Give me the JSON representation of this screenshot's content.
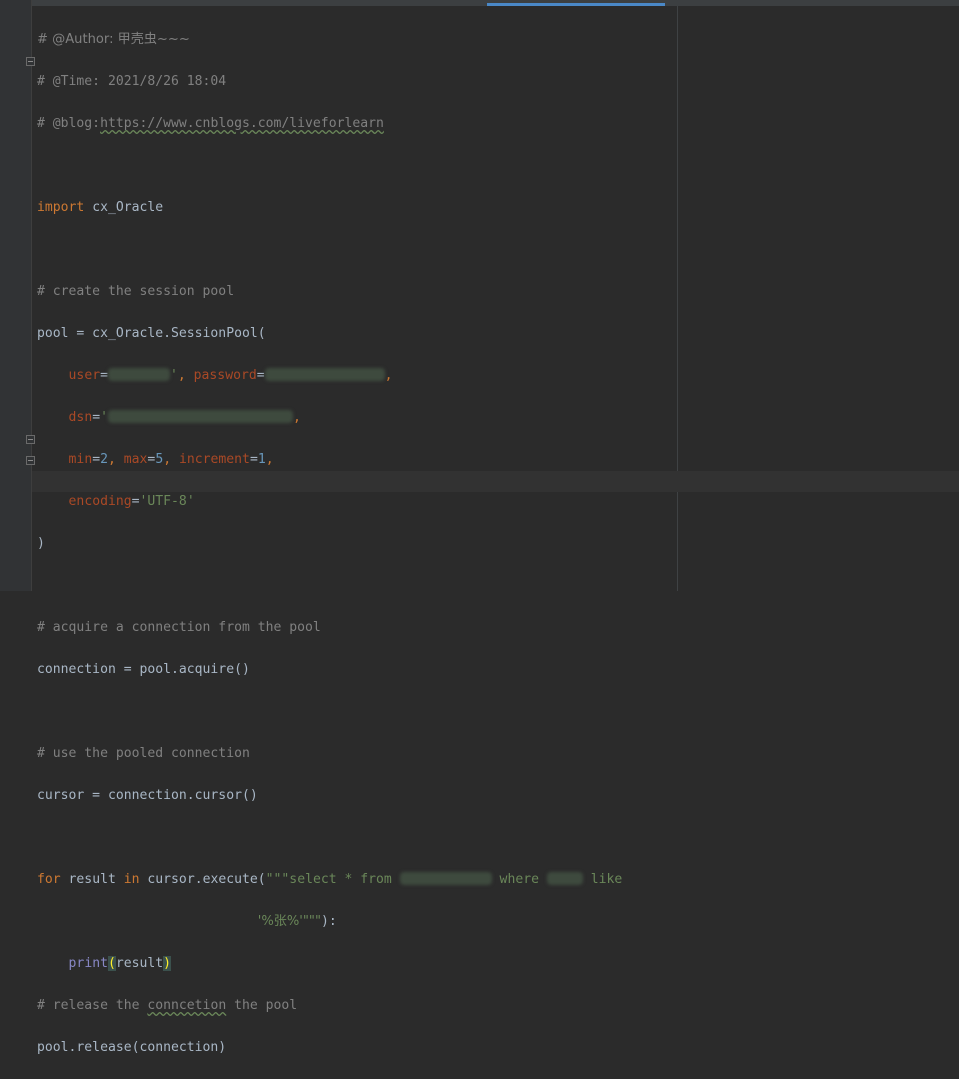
{
  "editor": {
    "lines": {
      "author": "# @Author: 甲壳虫~~~",
      "time": "# @Time: 2021/8/26 18:04",
      "blog_prefix": "# @blog:",
      "blog_url": "https://www.cnblogs.com/liveforlearn",
      "import_kw": "import",
      "import_mod": " cx_Oracle",
      "cm_create": "# create the session pool",
      "pool_assign": "pool = cx_Oracle.SessionPool(",
      "user_param": "user",
      "eq": "=",
      "comma": ", ",
      "password_param": "password",
      "dsn_param": "dsn",
      "quote": "'",
      "min_param": "min",
      "min_val": "2",
      "max_param": "max",
      "max_val": "5",
      "increment_param": "increment",
      "increment_val": "1",
      "trailing_comma": ",",
      "encoding_param": "encoding",
      "encoding_val": "'UTF-8'",
      "close_paren": ")",
      "cm_acquire": "# acquire a connection from the pool",
      "connection_assign": "connection = pool.acquire()",
      "cm_use": "# use the pooled connection",
      "cursor_assign": "cursor = connection.cursor()",
      "for_kw": "for",
      "result_var": " result ",
      "in_kw": "in",
      "execute_call": " cursor.execute(",
      "sql_start": "\"\"\"select * from ",
      "sql_where": " where ",
      "sql_like": " like",
      "sql_cont_indent": "                            ",
      "sql_pattern": "'%张%'\"\"\"",
      "execute_close": "):",
      "print_indent": "    ",
      "print_fn": "print",
      "open_paren": "(",
      "print_arg": "result",
      "cm_release_1": "# release the ",
      "cm_release_typo": "conncetion",
      "cm_release_2": " the pool",
      "release_call": "pool.release(connection)"
    }
  }
}
